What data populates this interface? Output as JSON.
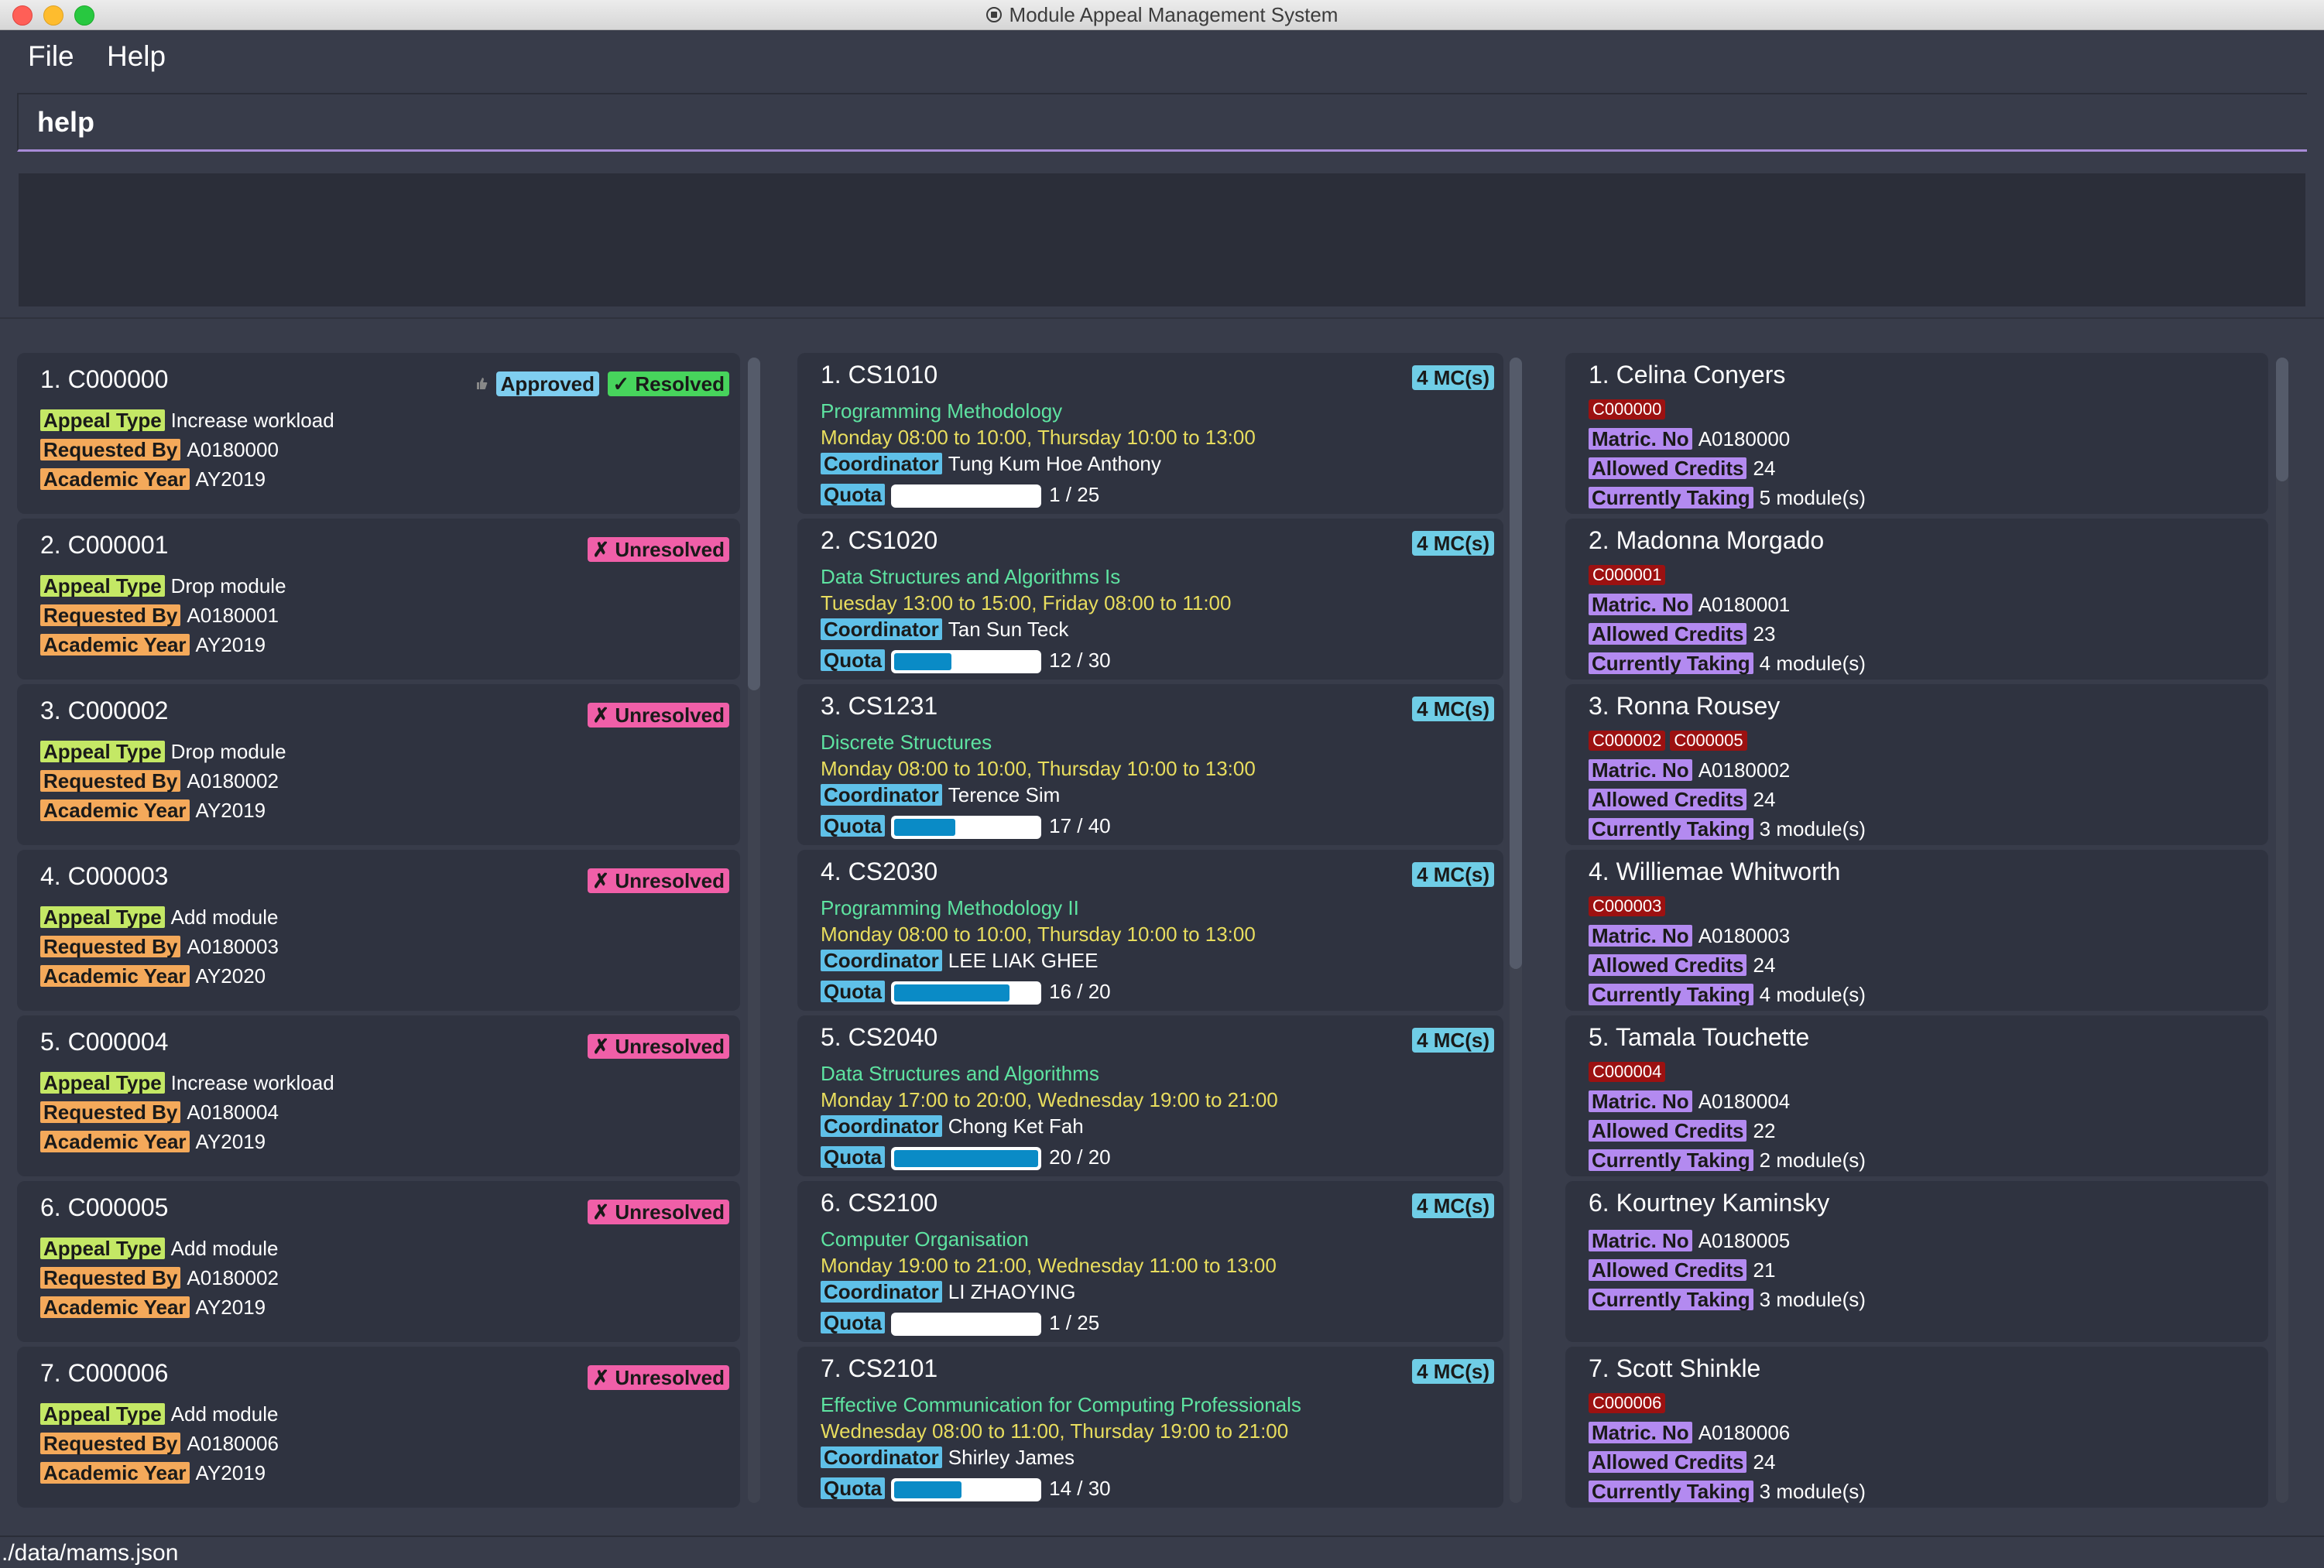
{
  "window": {
    "title": "Module Appeal Management System"
  },
  "menu": {
    "file": "File",
    "help": "Help"
  },
  "command": {
    "value": "help"
  },
  "labels": {
    "appeal_type": "Appeal Type",
    "requested_by": "Requested By",
    "academic_year": "Academic Year",
    "coordinator": "Coordinator",
    "quota": "Quota",
    "matric_no": "Matric. No",
    "allowed_credits": "Allowed Credits",
    "currently_taking": "Currently Taking",
    "modules_suffix": " module(s)"
  },
  "appeals": [
    {
      "index": "1.",
      "id": "C000000",
      "type": "Increase workload",
      "requested_by": "A0180000",
      "year": "AY2019",
      "badges": [
        "Approved",
        "✓ Resolved"
      ]
    },
    {
      "index": "2.",
      "id": "C000001",
      "type": "Drop module",
      "requested_by": "A0180001",
      "year": "AY2019",
      "badges": [
        "✗ Unresolved"
      ]
    },
    {
      "index": "3.",
      "id": "C000002",
      "type": "Drop module",
      "requested_by": "A0180002",
      "year": "AY2019",
      "badges": [
        "✗ Unresolved"
      ]
    },
    {
      "index": "4.",
      "id": "C000003",
      "type": "Add module",
      "requested_by": "A0180003",
      "year": "AY2020",
      "badges": [
        "✗ Unresolved"
      ]
    },
    {
      "index": "5.",
      "id": "C000004",
      "type": "Increase workload",
      "requested_by": "A0180004",
      "year": "AY2019",
      "badges": [
        "✗ Unresolved"
      ]
    },
    {
      "index": "6.",
      "id": "C000005",
      "type": "Add module",
      "requested_by": "A0180002",
      "year": "AY2019",
      "badges": [
        "✗ Unresolved"
      ]
    },
    {
      "index": "7.",
      "id": "C000006",
      "type": "Add module",
      "requested_by": "A0180006",
      "year": "AY2019",
      "badges": [
        "✗ Unresolved"
      ]
    }
  ],
  "modules": [
    {
      "index": "1.",
      "code": "CS1010",
      "name": "Programming Methodology",
      "time": "Monday 08:00 to 10:00, Thursday 10:00 to 13:00",
      "coordinator": "Tung Kum Hoe Anthony",
      "quota": "1 / 25",
      "fill": 0.04,
      "mc": "4 MC(s)"
    },
    {
      "index": "2.",
      "code": "CS1020",
      "name": "Data Structures and Algorithms Is",
      "time": "Tuesday 13:00 to 15:00, Friday 08:00 to 11:00",
      "coordinator": "Tan Sun Teck",
      "quota": "12 / 30",
      "fill": 0.4,
      "mc": "4 MC(s)"
    },
    {
      "index": "3.",
      "code": "CS1231",
      "name": "Discrete Structures",
      "time": "Monday 08:00 to 10:00, Thursday 10:00 to 13:00",
      "coordinator": "Terence Sim",
      "quota": "17 / 40",
      "fill": 0.425,
      "mc": "4 MC(s)"
    },
    {
      "index": "4.",
      "code": "CS2030",
      "name": "Programming Methodology II",
      "time": "Monday 08:00 to 10:00, Thursday 10:00 to 13:00",
      "coordinator": "LEE LIAK GHEE",
      "quota": "16 / 20",
      "fill": 0.8,
      "mc": "4 MC(s)"
    },
    {
      "index": "5.",
      "code": "CS2040",
      "name": "Data Structures and Algorithms",
      "time": "Monday 17:00 to 20:00, Wednesday 19:00 to 21:00",
      "coordinator": "Chong Ket Fah",
      "quota": "20 / 20",
      "fill": 1.0,
      "mc": "4 MC(s)"
    },
    {
      "index": "6.",
      "code": "CS2100",
      "name": "Computer Organisation",
      "time": "Monday 19:00 to 21:00, Wednesday 11:00 to 13:00",
      "coordinator": "LI ZHAOYING",
      "quota": "1 / 25",
      "fill": 0.04,
      "mc": "4 MC(s)"
    },
    {
      "index": "7.",
      "code": "CS2101",
      "name": "Effective Communication for Computing Professionals",
      "time": "Wednesday 08:00 to 11:00, Thursday 19:00 to 21:00",
      "coordinator": "Shirley James",
      "quota": "14 / 30",
      "fill": 0.467,
      "mc": "4 MC(s)"
    }
  ],
  "students": [
    {
      "index": "1.",
      "name": "Celina Conyers",
      "tags": [
        "C000000"
      ],
      "matric": "A0180000",
      "credits": "24",
      "taking": "5"
    },
    {
      "index": "2.",
      "name": "Madonna Morgado",
      "tags": [
        "C000001"
      ],
      "matric": "A0180001",
      "credits": "23",
      "taking": "4"
    },
    {
      "index": "3.",
      "name": "Ronna Rousey",
      "tags": [
        "C000002",
        "C000005"
      ],
      "matric": "A0180002",
      "credits": "24",
      "taking": "3"
    },
    {
      "index": "4.",
      "name": "Williemae Whitworth",
      "tags": [
        "C000003"
      ],
      "matric": "A0180003",
      "credits": "24",
      "taking": "4"
    },
    {
      "index": "5.",
      "name": "Tamala Touchette",
      "tags": [
        "C000004"
      ],
      "matric": "A0180004",
      "credits": "22",
      "taking": "2"
    },
    {
      "index": "6.",
      "name": "Kourtney Kaminsky",
      "tags": [],
      "matric": "A0180005",
      "credits": "21",
      "taking": "3"
    },
    {
      "index": "7.",
      "name": "Scott Shinkle",
      "tags": [
        "C000006"
      ],
      "matric": "A0180006",
      "credits": "24",
      "taking": "3"
    }
  ],
  "status": {
    "path": "./data/mams.json"
  }
}
